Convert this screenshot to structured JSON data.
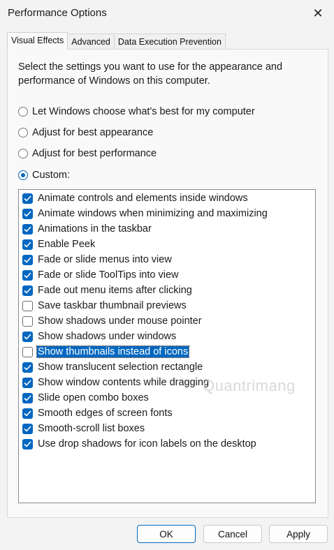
{
  "window": {
    "title": "Performance Options",
    "close_glyph": "✕"
  },
  "tabs": [
    {
      "label": "Visual Effects",
      "active": true
    },
    {
      "label": "Advanced",
      "active": false
    },
    {
      "label": "Data Execution Prevention",
      "active": false
    }
  ],
  "description": "Select the settings you want to use for the appearance and performance of Windows on this computer.",
  "radios": [
    {
      "label": "Let Windows choose what's best for my computer",
      "selected": false
    },
    {
      "label": "Adjust for best appearance",
      "selected": false
    },
    {
      "label": "Adjust for best performance",
      "selected": false
    },
    {
      "label": "Custom:",
      "selected": true
    }
  ],
  "options": [
    {
      "label": "Animate controls and elements inside windows",
      "checked": true
    },
    {
      "label": "Animate windows when minimizing and maximizing",
      "checked": true
    },
    {
      "label": "Animations in the taskbar",
      "checked": true
    },
    {
      "label": "Enable Peek",
      "checked": true
    },
    {
      "label": "Fade or slide menus into view",
      "checked": true
    },
    {
      "label": "Fade or slide ToolTips into view",
      "checked": true
    },
    {
      "label": "Fade out menu items after clicking",
      "checked": true
    },
    {
      "label": "Save taskbar thumbnail previews",
      "checked": false
    },
    {
      "label": "Show shadows under mouse pointer",
      "checked": false
    },
    {
      "label": "Show shadows under windows",
      "checked": true
    },
    {
      "label": "Show thumbnails instead of icons",
      "checked": false,
      "selected": true
    },
    {
      "label": "Show translucent selection rectangle",
      "checked": true
    },
    {
      "label": "Show window contents while dragging",
      "checked": true
    },
    {
      "label": "Slide open combo boxes",
      "checked": true
    },
    {
      "label": "Smooth edges of screen fonts",
      "checked": true
    },
    {
      "label": "Smooth-scroll list boxes",
      "checked": true
    },
    {
      "label": "Use drop shadows for icon labels on the desktop",
      "checked": true
    }
  ],
  "watermark": "Quantrimang",
  "buttons": {
    "ok": "OK",
    "cancel": "Cancel",
    "apply": "Apply"
  },
  "colors": {
    "accent": "#0067c0"
  }
}
